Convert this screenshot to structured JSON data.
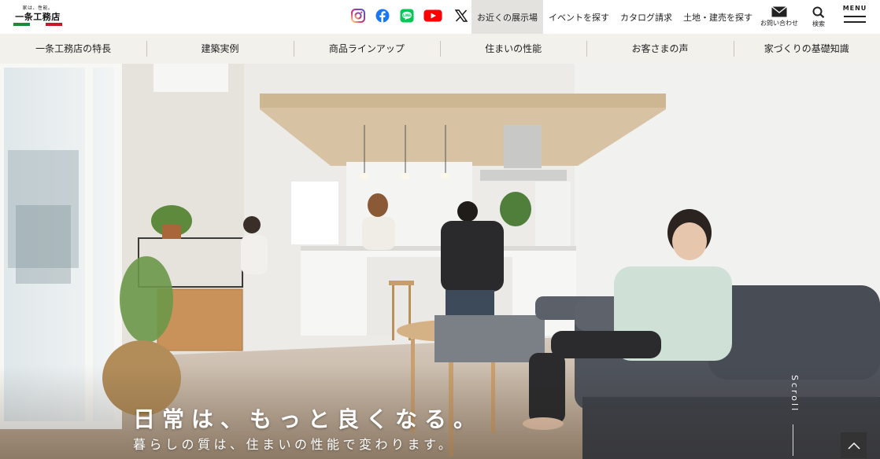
{
  "colors": {
    "logo_green": "#1b8a3a",
    "logo_red": "#c8192b",
    "active_tab_bg": "#e4e2df",
    "subnav_bg": "#f3f1ec",
    "instagram": "#d6249f",
    "facebook": "#1877f2",
    "line": "#06c755",
    "youtube": "#ff0000",
    "x": "#111111"
  },
  "logo": {
    "tagline": "家は、性能。",
    "brand": "一条工務店"
  },
  "social": [
    {
      "name": "instagram",
      "icon": "instagram-icon"
    },
    {
      "name": "facebook",
      "icon": "facebook-icon"
    },
    {
      "name": "line",
      "icon": "line-icon"
    },
    {
      "name": "youtube",
      "icon": "youtube-icon"
    },
    {
      "name": "x",
      "icon": "x-icon"
    }
  ],
  "topnav": {
    "showroom": "お近くの展示場",
    "events": "イベントを探す",
    "catalog": "カタログ請求",
    "land": "土地・建売を探す"
  },
  "utility": {
    "contact": "お問い合わせ",
    "search": "検索",
    "menu": "MENU"
  },
  "subnav": [
    "一条工務店の特長",
    "建築実例",
    "商品ラインアップ",
    "住まいの性能",
    "お客さまの声",
    "家づくりの基礎知識"
  ],
  "hero": {
    "headline": "日常は、もっと良くなる。",
    "subline": "暮らしの質は、住まいの性能で変わります。",
    "scroll": "Scroll"
  }
}
